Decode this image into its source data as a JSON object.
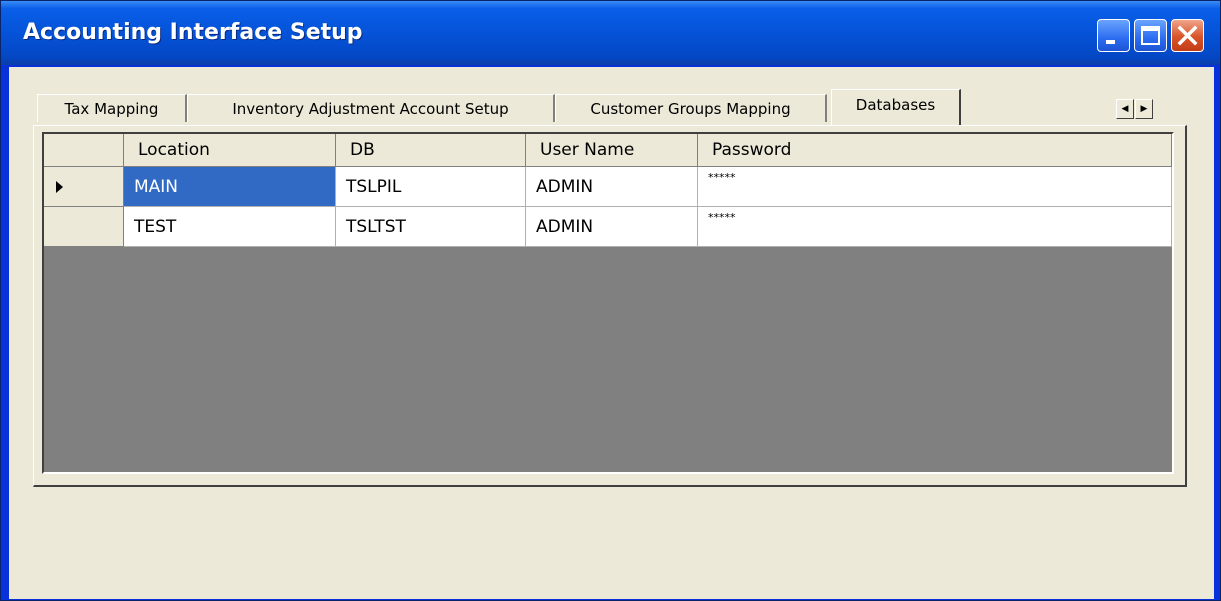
{
  "window": {
    "title": "Accounting Interface Setup"
  },
  "tabs": [
    {
      "label": "Tax Mapping"
    },
    {
      "label": "Inventory Adjustment Account Setup"
    },
    {
      "label": "Customer Groups Mapping"
    },
    {
      "label": "Databases",
      "active": true
    }
  ],
  "grid": {
    "columns": [
      "Location",
      "DB",
      "User Name",
      "Password"
    ],
    "rows": [
      {
        "location": "MAIN",
        "db": "TSLPIL",
        "user": "ADMIN",
        "password": "*****",
        "current": true,
        "selected_column": "location"
      },
      {
        "location": "TEST",
        "db": "TSLTST",
        "user": "ADMIN",
        "password": "*****"
      }
    ]
  },
  "icons": {
    "minimize": "minimize-icon",
    "maximize": "maximize-icon",
    "close": "close-icon",
    "row_indicator": "triangle-right-icon",
    "scroll_left": "arrow-left-icon",
    "scroll_right": "arrow-right-icon"
  },
  "colors": {
    "titlebar": "#0553d8",
    "selection": "#316ac5",
    "client": "#ece9d8",
    "grid_background": "#808080"
  }
}
